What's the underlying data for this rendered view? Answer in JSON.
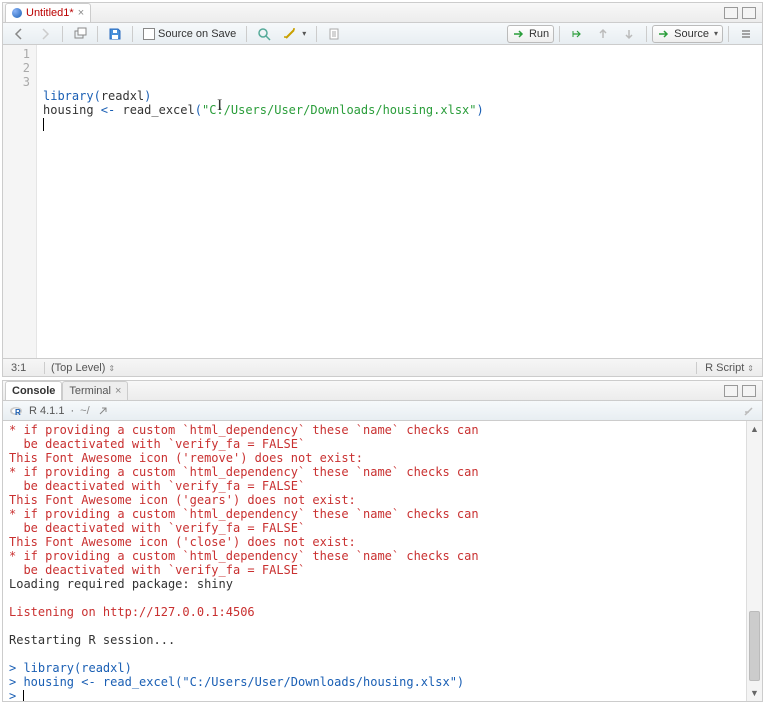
{
  "editor": {
    "tab": {
      "title": "Untitled1*",
      "dirty": true
    },
    "toolbar": {
      "source_on_save": "Source on Save",
      "run": "Run",
      "source": "Source"
    },
    "code": {
      "lines": [
        {
          "n": "1",
          "tokens": [
            [
              "kw",
              "library"
            ],
            [
              "paren",
              "("
            ],
            [
              "fn",
              "readxl"
            ],
            [
              "paren",
              ")"
            ]
          ]
        },
        {
          "n": "2",
          "tokens": [
            [
              "fn",
              "housing "
            ],
            [
              "paren",
              "<-"
            ],
            [
              "fn",
              " read_excel"
            ],
            [
              "paren",
              "("
            ],
            [
              "str",
              "\"C:/Users/User/Downloads/housing.xlsx\""
            ],
            [
              "paren",
              ")"
            ]
          ]
        },
        {
          "n": "3",
          "tokens": []
        }
      ]
    },
    "status": {
      "pos": "3:1",
      "scope": "(Top Level)",
      "lang": "R Script"
    }
  },
  "console": {
    "tabs": {
      "console": "Console",
      "terminal": "Terminal"
    },
    "header": {
      "version": "R 4.1.1",
      "path": "~/"
    },
    "lines": [
      [
        "red",
        "* if providing a custom `html_dependency` these `name` checks can"
      ],
      [
        "red",
        "  be deactivated with `verify_fa = FALSE`"
      ],
      [
        "red",
        "This Font Awesome icon ('remove') does not exist:"
      ],
      [
        "red",
        "* if providing a custom `html_dependency` these `name` checks can"
      ],
      [
        "red",
        "  be deactivated with `verify_fa = FALSE`"
      ],
      [
        "red",
        "This Font Awesome icon ('gears') does not exist:"
      ],
      [
        "red",
        "* if providing a custom `html_dependency` these `name` checks can"
      ],
      [
        "red",
        "  be deactivated with `verify_fa = FALSE`"
      ],
      [
        "red",
        "This Font Awesome icon ('close') does not exist:"
      ],
      [
        "red",
        "* if providing a custom `html_dependency` these `name` checks can"
      ],
      [
        "red",
        "  be deactivated with `verify_fa = FALSE`"
      ],
      [
        "plain",
        "Loading required package: shiny"
      ],
      [
        "plain",
        ""
      ],
      [
        "red",
        "Listening on http://127.0.0.1:4506"
      ],
      [
        "plain",
        ""
      ],
      [
        "plain",
        "Restarting R session..."
      ],
      [
        "plain",
        ""
      ],
      [
        "prompt",
        "> ",
        "library(readxl)"
      ],
      [
        "prompt",
        "> ",
        "housing <- read_excel(\"C:/Users/User/Downloads/housing.xlsx\")"
      ],
      [
        "prompt",
        "> ",
        "|"
      ]
    ]
  }
}
